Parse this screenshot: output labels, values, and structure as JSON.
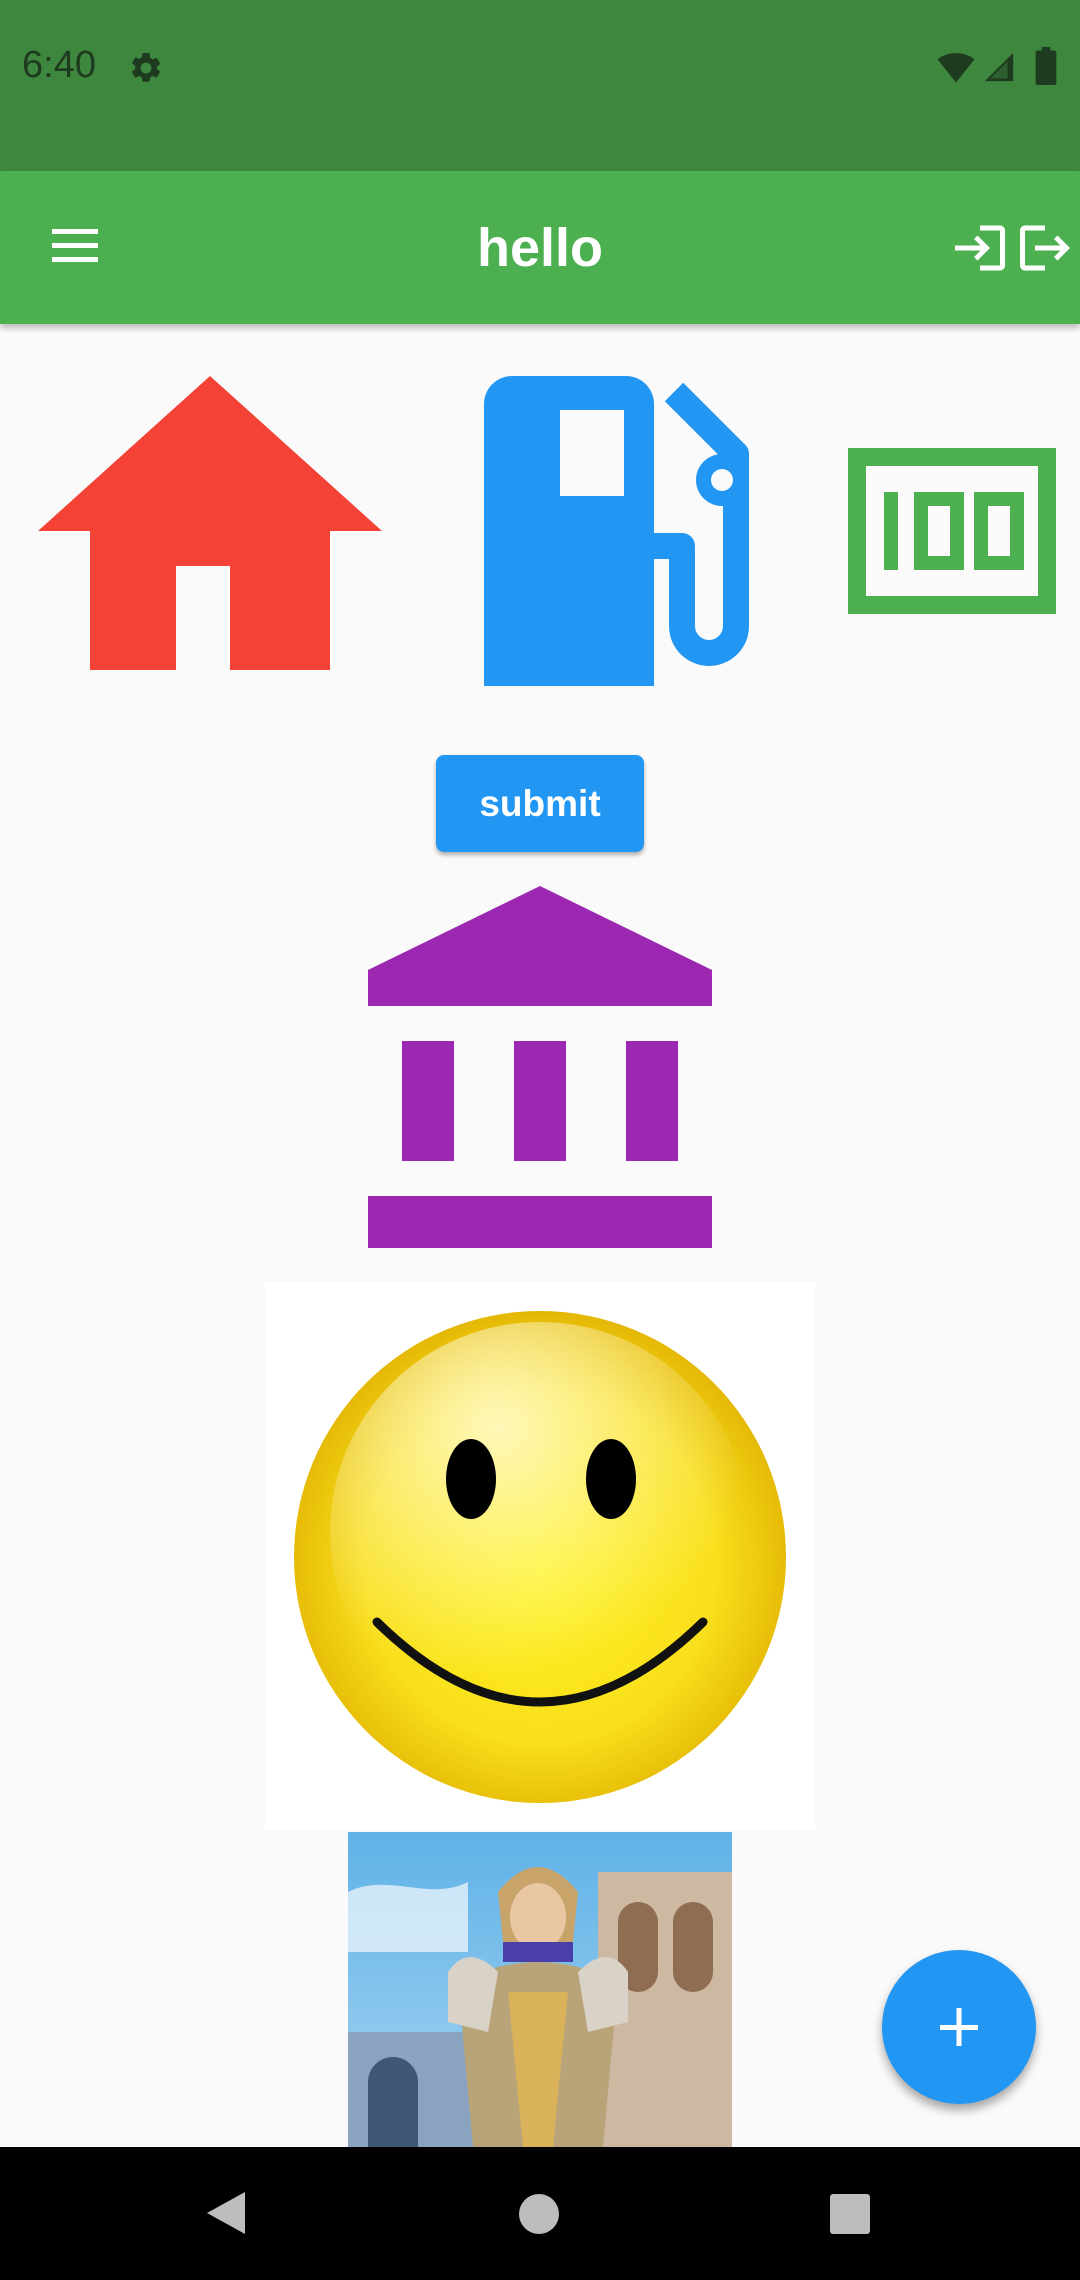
{
  "status_bar": {
    "time": "6:40",
    "icons": [
      "settings-icon",
      "wifi-icon",
      "signal-icon",
      "battery-icon"
    ]
  },
  "app_bar": {
    "title": "hello",
    "menu_icon": "menu-icon",
    "actions": [
      "login-icon",
      "logout-icon"
    ],
    "color": "#4caf50"
  },
  "icons_row": [
    {
      "name": "home-icon",
      "color": "#f44336"
    },
    {
      "name": "gas-station-icon",
      "color": "#2196f3"
    },
    {
      "name": "hundred-icon",
      "color": "#4caf50"
    }
  ],
  "submit_button": {
    "label": "submit",
    "color": "#2196f3"
  },
  "bank_icon": {
    "name": "bank-icon",
    "color": "#9c27b0"
  },
  "images": [
    "smiley-face-image",
    "game-character-image"
  ],
  "fab": {
    "icon": "add-icon",
    "color": "#2196f3"
  },
  "nav_bar": {
    "buttons": [
      "back-button",
      "home-button",
      "recents-button"
    ]
  }
}
